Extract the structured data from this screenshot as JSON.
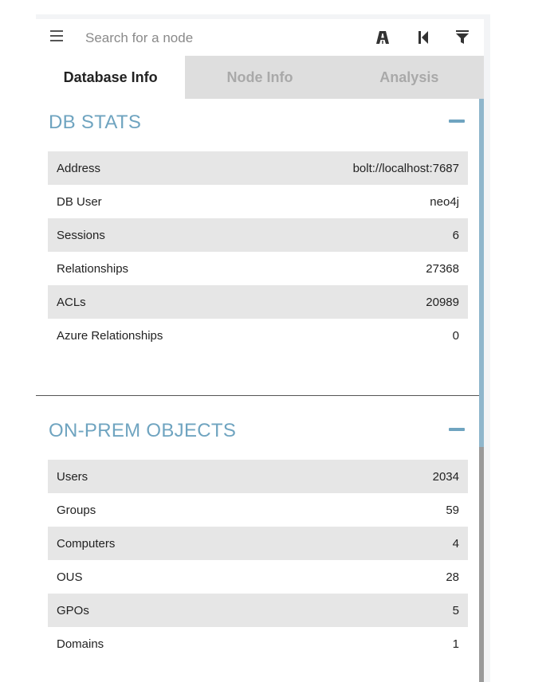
{
  "search": {
    "placeholder": "Search for a node"
  },
  "tabs": [
    {
      "label": "Database Info",
      "active": true
    },
    {
      "label": "Node Info",
      "active": false
    },
    {
      "label": "Analysis",
      "active": false
    }
  ],
  "db_stats": {
    "title": "DB STATS",
    "rows": [
      {
        "label": "Address",
        "value": "bolt://localhost:7687"
      },
      {
        "label": "DB User",
        "value": "neo4j"
      },
      {
        "label": "Sessions",
        "value": "6"
      },
      {
        "label": "Relationships",
        "value": "27368"
      },
      {
        "label": "ACLs",
        "value": "20989"
      },
      {
        "label": "Azure Relationships",
        "value": "0"
      }
    ]
  },
  "onprem_objects": {
    "title": "ON-PREM OBJECTS",
    "rows": [
      {
        "label": "Users",
        "value": "2034"
      },
      {
        "label": "Groups",
        "value": "59"
      },
      {
        "label": "Computers",
        "value": "4"
      },
      {
        "label": "OUS",
        "value": "28"
      },
      {
        "label": "GPOs",
        "value": "5"
      },
      {
        "label": "Domains",
        "value": "1"
      }
    ]
  },
  "icons": [
    "menu-icon",
    "pathfinding-icon",
    "back-icon",
    "filter-icon",
    "collapse-icon"
  ],
  "colors": {
    "accent": "#6fa4c0",
    "row_shade": "#e6e6e6",
    "tab_inactive": "#dedede"
  }
}
